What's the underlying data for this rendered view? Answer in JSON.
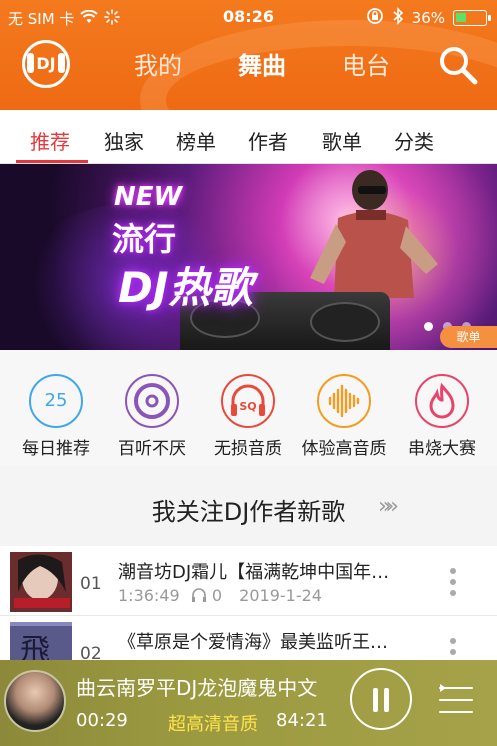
{
  "status": {
    "carrier": "无 SIM 卡",
    "time": "08:26",
    "battery": "36%"
  },
  "nav": {
    "logo": "DJ",
    "tabs": [
      "我的",
      "舞曲",
      "电台"
    ],
    "active_tab": "舞曲"
  },
  "categories": {
    "items": [
      "推荐",
      "独家",
      "榜单",
      "作者",
      "歌单",
      "分类"
    ],
    "active": "推荐"
  },
  "banner": {
    "line1": "NEW",
    "line2": "流行",
    "line3": "DJ热歌",
    "tag": "歌单",
    "page_count": 3,
    "active_page": 1
  },
  "quick_menu": [
    {
      "label": "每日推荐",
      "icon": "calendar-icon",
      "icon_text": "25",
      "color": "#3fa9e8"
    },
    {
      "label": "百听不厌",
      "icon": "vinyl-icon",
      "color": "#8a55b8"
    },
    {
      "label": "无损音质",
      "icon": "headphones-sq-icon",
      "icon_text": "SQ",
      "color": "#e84a3a"
    },
    {
      "label": "体验高音质",
      "icon": "waveform-icon",
      "color": "#f39c1e"
    },
    {
      "label": "串烧大赛",
      "icon": "flame-icon",
      "color": "#e8436a"
    }
  ],
  "section": {
    "title": "我关注DJ作者新歌",
    "arrows": "»»"
  },
  "songs": [
    {
      "no": "01",
      "title": "潮音坊DJ霜儿【福满乾坤中国年…",
      "duration": "1:36:49",
      "plays": "0",
      "date": "2019-1-24"
    },
    {
      "no": "02",
      "title": "《草原是个爱情海》最美监听王…",
      "duration": "",
      "plays": "",
      "date": ""
    }
  ],
  "player": {
    "title": "曲云南罗平DJ龙泡魔鬼中文",
    "elapsed": "00:29",
    "quality": "超高清音质",
    "total": "84:21"
  }
}
